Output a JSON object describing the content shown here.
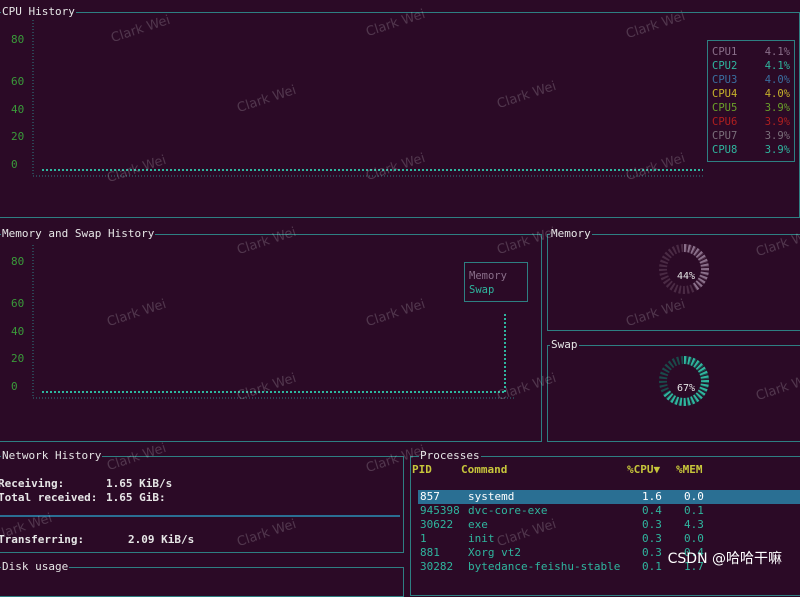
{
  "watermark_text": "Clark Wei",
  "watermark_credit": "CSDN @哈哈干嘛",
  "cpu_history": {
    "title": "CPU History",
    "y_ticks": [
      "80",
      "60",
      "40",
      "20",
      "0"
    ],
    "legend": [
      {
        "name": "CPU1",
        "value": "4.1%",
        "color": "#8a6f8a"
      },
      {
        "name": "CPU2",
        "value": "4.1%",
        "color": "#2fb59e"
      },
      {
        "name": "CPU3",
        "value": "4.0%",
        "color": "#3a6fa0"
      },
      {
        "name": "CPU4",
        "value": "4.0%",
        "color": "#c7b22a"
      },
      {
        "name": "CPU5",
        "value": "3.9%",
        "color": "#6aa02a"
      },
      {
        "name": "CPU6",
        "value": "3.9%",
        "color": "#b01f1f"
      },
      {
        "name": "CPU7",
        "value": "3.9%",
        "color": "#7a6f7a"
      },
      {
        "name": "CPU8",
        "value": "3.9%",
        "color": "#2fb59e"
      }
    ]
  },
  "mem_swap_history": {
    "title": "Memory and Swap History",
    "y_ticks": [
      "80",
      "60",
      "40",
      "20",
      "0"
    ],
    "legend": [
      {
        "name": "Memory",
        "color": "#8a6f8a"
      },
      {
        "name": "Swap",
        "color": "#2fb59e"
      }
    ]
  },
  "memory": {
    "title": "Memory",
    "percent": "44%",
    "value": 44,
    "color": "#8a6f8a"
  },
  "swap": {
    "title": "Swap",
    "percent": "67%",
    "value": 67,
    "color": "#2fb59e"
  },
  "network": {
    "title": "Network History",
    "receiving_label": "Receiving:",
    "receiving_value": "1.65 KiB/s",
    "total_received_label": "Total received:",
    "total_received_value": "1.65 GiB:",
    "transferring_label": "Transferring:",
    "transferring_value": "2.09 KiB/s"
  },
  "disk": {
    "title": "Disk usage"
  },
  "processes": {
    "title": "Processes",
    "columns": {
      "pid": "PID",
      "command": "Command",
      "cpu": "%CPU▼",
      "mem": "%MEM"
    },
    "rows": [
      {
        "pid": "857",
        "command": "systemd",
        "cpu": "1.6",
        "mem": "0.0",
        "selected": true
      },
      {
        "pid": "945398",
        "command": "dvc-core-exe",
        "cpu": "0.4",
        "mem": "0.1"
      },
      {
        "pid": "30622",
        "command": "exe",
        "cpu": "0.3",
        "mem": "4.3"
      },
      {
        "pid": "1",
        "command": "init",
        "cpu": "0.3",
        "mem": "0.0"
      },
      {
        "pid": "881",
        "command": "Xorg vt2",
        "cpu": "0.3",
        "mem": "0.4"
      },
      {
        "pid": "30282",
        "command": "bytedance-feishu-stable",
        "cpu": "0.1",
        "mem": "1.7"
      }
    ]
  }
}
